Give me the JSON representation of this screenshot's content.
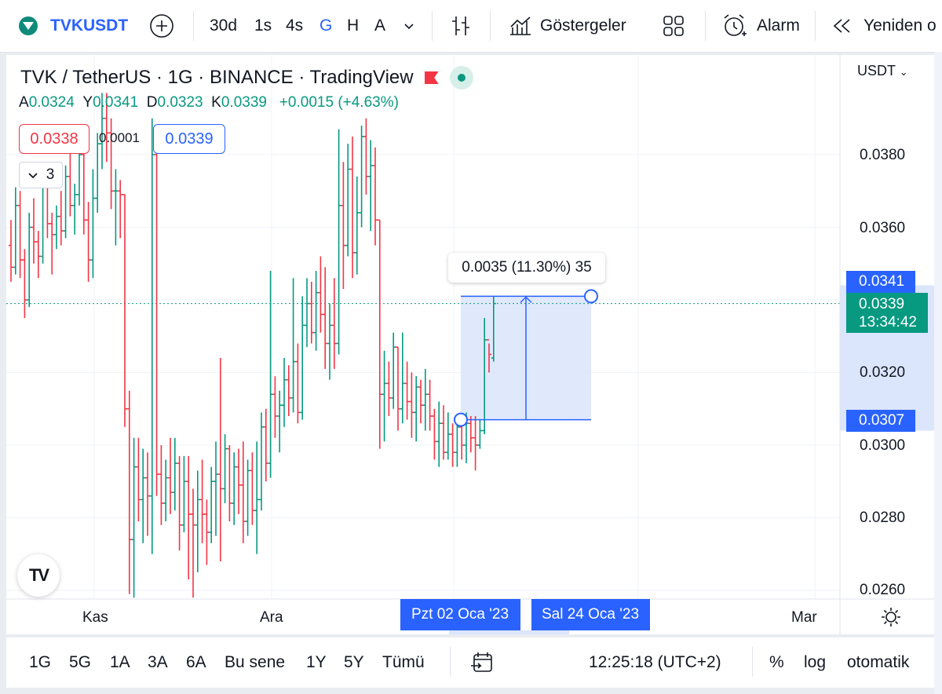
{
  "toolbar": {
    "symbol": "TVKUSDT",
    "intervals": [
      "30d",
      "1s",
      "4s",
      "G",
      "H",
      "A"
    ],
    "active_interval": "G",
    "indicators_label": "Göstergeler",
    "alarm_label": "Alarm",
    "replay_label": "Yeniden o"
  },
  "legend": {
    "title": "TVK / TetherUS · 1G · BINANCE · TradingView",
    "open_label": "A",
    "open_value": "0.0324",
    "high_label": "Y",
    "high_value": "0.0341",
    "low_label": "D",
    "low_value": "0.0323",
    "close_label": "K",
    "close_value": "0.0339",
    "change": "+0.0015 (+4.63%)",
    "sell_price": "0.0338",
    "spread": "0.0001",
    "buy_price": "0.0339",
    "collapse_count": "3"
  },
  "price_axis": {
    "unit": "USDT",
    "ticks": [
      "0.0380",
      "0.0360",
      "0.0320",
      "0.0300",
      "0.0280",
      "0.0260"
    ],
    "range_high_tag": "0.0341",
    "last_price_tag": "0.0339",
    "countdown": "13:34:42",
    "range_low_tag": "0.0307"
  },
  "time_axis": {
    "ticks": [
      "Kas",
      "Ara",
      "Mar"
    ],
    "range_start_tag": "Pzt 02 Oca '23",
    "range_end_tag": "Sal 24 Oca '23"
  },
  "measure": {
    "label": "0.0035 (11.30%) 35"
  },
  "bottom": {
    "ranges": [
      "1G",
      "5G",
      "1A",
      "3A",
      "6A",
      "Bu sene",
      "1Y",
      "5Y",
      "Tümü"
    ],
    "time": "12:25:18 (UTC+2)",
    "percent_label": "%",
    "log_label": "log",
    "auto_label": "otomatik"
  },
  "logo_text": "TV",
  "colors": {
    "up": "#089981",
    "down": "#f23645",
    "accent": "#2962ff",
    "measure_fill": "#dbe5fc"
  },
  "chart_data": {
    "type": "ohlc",
    "y_range": [
      0.0255,
      0.039
    ],
    "last_price": 0.0339,
    "measure": {
      "from": 0.0307,
      "to": 0.0341,
      "start": "2023-01-02",
      "end": "2023-01-24"
    },
    "bars": [
      [
        0.0355,
        0.0362,
        0.0345,
        0.0349
      ],
      [
        0.0349,
        0.0371,
        0.0347,
        0.0366
      ],
      [
        0.0366,
        0.037,
        0.0346,
        0.0351
      ],
      [
        0.0351,
        0.0354,
        0.0335,
        0.034
      ],
      [
        0.034,
        0.0364,
        0.0338,
        0.036
      ],
      [
        0.036,
        0.0368,
        0.035,
        0.0356
      ],
      [
        0.0356,
        0.0359,
        0.0346,
        0.0352
      ],
      [
        0.0352,
        0.0376,
        0.035,
        0.0372
      ],
      [
        0.0372,
        0.0378,
        0.0357,
        0.0361
      ],
      [
        0.0361,
        0.0364,
        0.0347,
        0.0358
      ],
      [
        0.0358,
        0.0366,
        0.0354,
        0.0363
      ],
      [
        0.0363,
        0.037,
        0.0355,
        0.0359
      ],
      [
        0.0359,
        0.0377,
        0.0357,
        0.0374
      ],
      [
        0.0374,
        0.0381,
        0.0363,
        0.0366
      ],
      [
        0.0366,
        0.0372,
        0.0358,
        0.0369
      ],
      [
        0.0369,
        0.0384,
        0.0366,
        0.038
      ],
      [
        0.038,
        0.0383,
        0.0358,
        0.0362
      ],
      [
        0.0362,
        0.0367,
        0.0345,
        0.0351
      ],
      [
        0.0351,
        0.0376,
        0.0346,
        0.0368
      ],
      [
        0.0368,
        0.0386,
        0.0364,
        0.0383
      ],
      [
        0.0383,
        0.0397,
        0.0376,
        0.039
      ],
      [
        0.039,
        0.0397,
        0.0378,
        0.0386
      ],
      [
        0.0386,
        0.039,
        0.0365,
        0.037
      ],
      [
        0.037,
        0.0376,
        0.0355,
        0.037
      ],
      [
        0.037,
        0.0373,
        0.0357,
        0.0369
      ],
      [
        0.0369,
        0.0369,
        0.0305,
        0.031
      ],
      [
        0.031,
        0.0315,
        0.0259,
        0.0274
      ],
      [
        0.0274,
        0.0302,
        0.0258,
        0.0294
      ],
      [
        0.0294,
        0.0302,
        0.0279,
        0.0285
      ],
      [
        0.0285,
        0.0299,
        0.0273,
        0.0291
      ],
      [
        0.0291,
        0.0298,
        0.0275,
        0.0286
      ],
      [
        0.0286,
        0.039,
        0.027,
        0.038
      ],
      [
        0.038,
        0.0381,
        0.0286,
        0.0292
      ],
      [
        0.0292,
        0.03,
        0.0278,
        0.0284
      ],
      [
        0.0284,
        0.0296,
        0.0279,
        0.0291
      ],
      [
        0.0291,
        0.0302,
        0.0281,
        0.0287
      ],
      [
        0.0287,
        0.0302,
        0.0282,
        0.0295
      ],
      [
        0.0295,
        0.0297,
        0.0271,
        0.0278
      ],
      [
        0.0278,
        0.0297,
        0.0276,
        0.029
      ],
      [
        0.029,
        0.0297,
        0.0263,
        0.0281
      ],
      [
        0.0281,
        0.0288,
        0.0258,
        0.0278
      ],
      [
        0.0278,
        0.0293,
        0.0265,
        0.0285
      ],
      [
        0.0285,
        0.0296,
        0.0273,
        0.0281
      ],
      [
        0.0281,
        0.0285,
        0.0267,
        0.0276
      ],
      [
        0.0276,
        0.0294,
        0.0273,
        0.029
      ],
      [
        0.029,
        0.0301,
        0.0275,
        0.0292
      ],
      [
        0.0292,
        0.0324,
        0.0268,
        0.0288
      ],
      [
        0.0288,
        0.0303,
        0.0284,
        0.0299
      ],
      [
        0.0299,
        0.03,
        0.0279,
        0.0284
      ],
      [
        0.0284,
        0.0298,
        0.0278,
        0.0294
      ],
      [
        0.0294,
        0.0299,
        0.0281,
        0.0289
      ],
      [
        0.0289,
        0.0301,
        0.0273,
        0.0279
      ],
      [
        0.0279,
        0.0296,
        0.0275,
        0.0293
      ],
      [
        0.0293,
        0.0298,
        0.0278,
        0.0282
      ],
      [
        0.0282,
        0.0301,
        0.027,
        0.0285
      ],
      [
        0.0285,
        0.0309,
        0.0282,
        0.0305
      ],
      [
        0.0305,
        0.031,
        0.029,
        0.0295
      ],
      [
        0.0295,
        0.0348,
        0.0291,
        0.0314
      ],
      [
        0.0314,
        0.0319,
        0.0302,
        0.0308
      ],
      [
        0.0308,
        0.0315,
        0.0298,
        0.0311
      ],
      [
        0.0311,
        0.0324,
        0.0305,
        0.0318
      ],
      [
        0.0318,
        0.0322,
        0.0308,
        0.0313
      ],
      [
        0.0313,
        0.0346,
        0.0309,
        0.0323
      ],
      [
        0.0323,
        0.0328,
        0.0306,
        0.0309
      ],
      [
        0.0309,
        0.0341,
        0.0307,
        0.0333
      ],
      [
        0.0333,
        0.0346,
        0.0327,
        0.0339
      ],
      [
        0.0339,
        0.0345,
        0.0328,
        0.0331
      ],
      [
        0.0331,
        0.0348,
        0.0326,
        0.0342
      ],
      [
        0.0342,
        0.0352,
        0.0331,
        0.0336
      ],
      [
        0.0336,
        0.0349,
        0.0321,
        0.0328
      ],
      [
        0.0328,
        0.0339,
        0.0318,
        0.0333
      ],
      [
        0.0333,
        0.0346,
        0.0321,
        0.0328
      ],
      [
        0.0328,
        0.0387,
        0.0325,
        0.0366
      ],
      [
        0.0366,
        0.0378,
        0.0343,
        0.0355
      ],
      [
        0.0355,
        0.0383,
        0.0352,
        0.0376
      ],
      [
        0.0376,
        0.0385,
        0.0346,
        0.0353
      ],
      [
        0.0353,
        0.0374,
        0.0347,
        0.0364
      ],
      [
        0.0364,
        0.0388,
        0.036,
        0.0385
      ],
      [
        0.0385,
        0.039,
        0.0369,
        0.0374
      ],
      [
        0.0374,
        0.0384,
        0.0359,
        0.0377
      ],
      [
        0.0377,
        0.0382,
        0.0355,
        0.0362
      ],
      [
        0.0362,
        0.0362,
        0.0299,
        0.0314
      ],
      [
        0.0314,
        0.0326,
        0.0301,
        0.0317
      ],
      [
        0.0317,
        0.0323,
        0.0308,
        0.0313
      ],
      [
        0.0313,
        0.0331,
        0.031,
        0.0327
      ],
      [
        0.0327,
        0.0327,
        0.0304,
        0.031
      ],
      [
        0.031,
        0.0331,
        0.0306,
        0.0317
      ],
      [
        0.0317,
        0.0323,
        0.0307,
        0.0312
      ],
      [
        0.0312,
        0.032,
        0.0302,
        0.0309
      ],
      [
        0.0309,
        0.0319,
        0.0301,
        0.0316
      ],
      [
        0.0316,
        0.0318,
        0.0306,
        0.0311
      ],
      [
        0.0311,
        0.0321,
        0.0304,
        0.0314
      ],
      [
        0.0314,
        0.0318,
        0.0304,
        0.0308
      ],
      [
        0.0308,
        0.031,
        0.0296,
        0.0301
      ],
      [
        0.0301,
        0.0312,
        0.0294,
        0.0306
      ],
      [
        0.0306,
        0.0311,
        0.0296,
        0.0298
      ],
      [
        0.0298,
        0.0309,
        0.0296,
        0.0303
      ],
      [
        0.0303,
        0.0306,
        0.0294,
        0.0298
      ],
      [
        0.0298,
        0.0308,
        0.0294,
        0.0305
      ],
      [
        0.0305,
        0.0307,
        0.0296,
        0.03
      ],
      [
        0.03,
        0.0309,
        0.0295,
        0.0306
      ],
      [
        0.0306,
        0.0308,
        0.0298,
        0.0302
      ],
      [
        0.0302,
        0.0308,
        0.0293,
        0.03
      ],
      [
        0.03,
        0.0307,
        0.0299,
        0.0304
      ],
      [
        0.0304,
        0.0335,
        0.0303,
        0.0329
      ],
      [
        0.0329,
        0.0328,
        0.032,
        0.0325
      ],
      [
        0.0324,
        0.0341,
        0.0323,
        0.0339
      ]
    ]
  }
}
